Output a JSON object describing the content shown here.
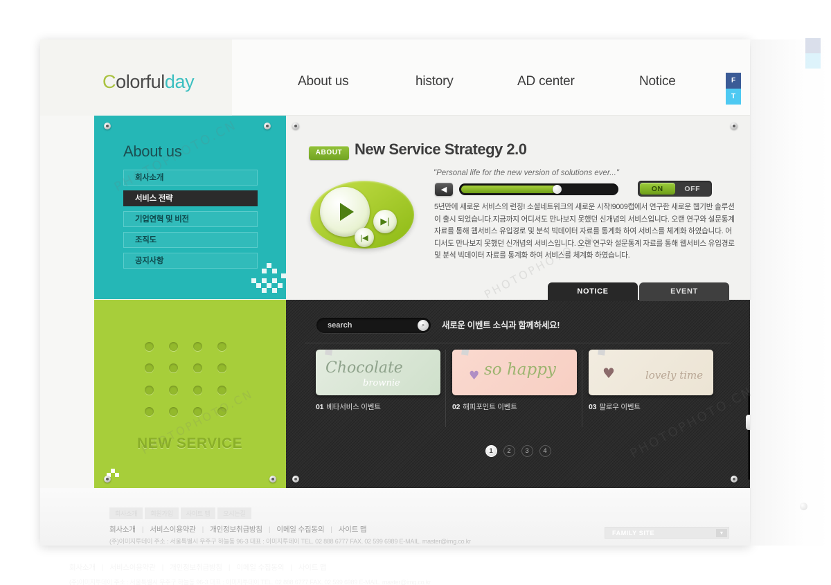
{
  "brand": {
    "logo_c": "C",
    "logo_mid": "olorful",
    "logo_day": "day",
    "accent_teal": "#25b7b6",
    "accent_green": "#a7ce3a",
    "accent_dark": "#2c2c2c"
  },
  "nav": {
    "items": [
      {
        "label": "About us"
      },
      {
        "label": "history"
      },
      {
        "label": "AD center"
      },
      {
        "label": "Notice"
      }
    ]
  },
  "social": {
    "facebook": "F",
    "twitter": "T"
  },
  "sidebar": {
    "title": "About us",
    "items": [
      {
        "label": "회사소개",
        "active": false
      },
      {
        "label": "서비스 전략",
        "active": true
      },
      {
        "label": "기업연혁 및 비전",
        "active": false
      },
      {
        "label": "조직도",
        "active": false
      },
      {
        "label": "공지사항",
        "active": false
      }
    ]
  },
  "promo": {
    "label": "NEW SERVICE"
  },
  "content": {
    "badge": "ABOUT",
    "title": "New Service Strategy 2.0",
    "quote": "\"Personal life for the new version of solutions ever...\"",
    "body": "5년만에 새로운 서비스의 런칭! 소셜네트워크의 새로운 시작!9009캡에서 연구한 새로운 웹기반 솔루션이 출시 되었습니다.지금까지 어디서도 만나보지 못했던 신개념의 서비스입니다. 오랜 연구와 설문통계 자료를 통해 웹서비스 유입경로 및 분석 빅데이터 자료를 통계화 하여 서비스를 체계화 하였습니다. 어디서도 만나보지 못했던 신개념의 서비스입니다. 오랜 연구와 설문통계 자료를 통해 웹서비스 유입경로 및 분석 빅데이터 자료를 통계화 하여 서비스를 체계화 하였습니다.",
    "player": {
      "play_icon": "play-icon",
      "next_icon": "next-track-icon",
      "prev_icon": "prev-track-icon",
      "next_glyph": "▶|",
      "prev_glyph": "|◀",
      "volume_glyph": "◀",
      "volume_percent": 60
    },
    "toggle": {
      "on_label": "ON",
      "off_label": "OFF",
      "state": "ON"
    }
  },
  "tabs": [
    {
      "label": "NOTICE",
      "active": true
    },
    {
      "label": "EVENT",
      "active": false
    }
  ],
  "events": {
    "search_placeholder": "search",
    "search_value": "",
    "search_icon_glyph": "⌕",
    "headline": "새로운 이벤트 소식과 함께하세요!",
    "cards": [
      {
        "num": "01",
        "label": "베타서비스 이벤트",
        "art_main": "Chocolate",
        "art_sub": "brownie"
      },
      {
        "num": "02",
        "label": "해피포인트 이벤트",
        "art_main": "so happy",
        "art_sub": "♥"
      },
      {
        "num": "03",
        "label": "팔로우 이벤트",
        "art_main": "lovely time",
        "art_sub": "♥"
      }
    ],
    "pagination": [
      {
        "label": "1",
        "active": true
      },
      {
        "label": "2",
        "active": false
      },
      {
        "label": "3",
        "active": false
      },
      {
        "label": "4",
        "active": false
      }
    ]
  },
  "footer": {
    "top_tabs": [
      "회사소개",
      "회원가입",
      "사이트 맵",
      "오시는길"
    ],
    "links": [
      "회사소개",
      "서비스이용약관",
      "개인정보취급방침",
      "이메일 수집동의",
      "사이트 맵"
    ],
    "separator": "|",
    "address": "(주)이미지투데이   주소 : 서울특별시 우주구 하늘동 96-3  대표 : 이미지투데이  TEL. 02 888 6777  FAX. 02 599 6989 E-MAIL. master@img.co.kr",
    "family_site": "FAMILY SITE",
    "family_arrow": "▼"
  },
  "watermark": {
    "text": "PHOTOPHOTO.CN"
  }
}
